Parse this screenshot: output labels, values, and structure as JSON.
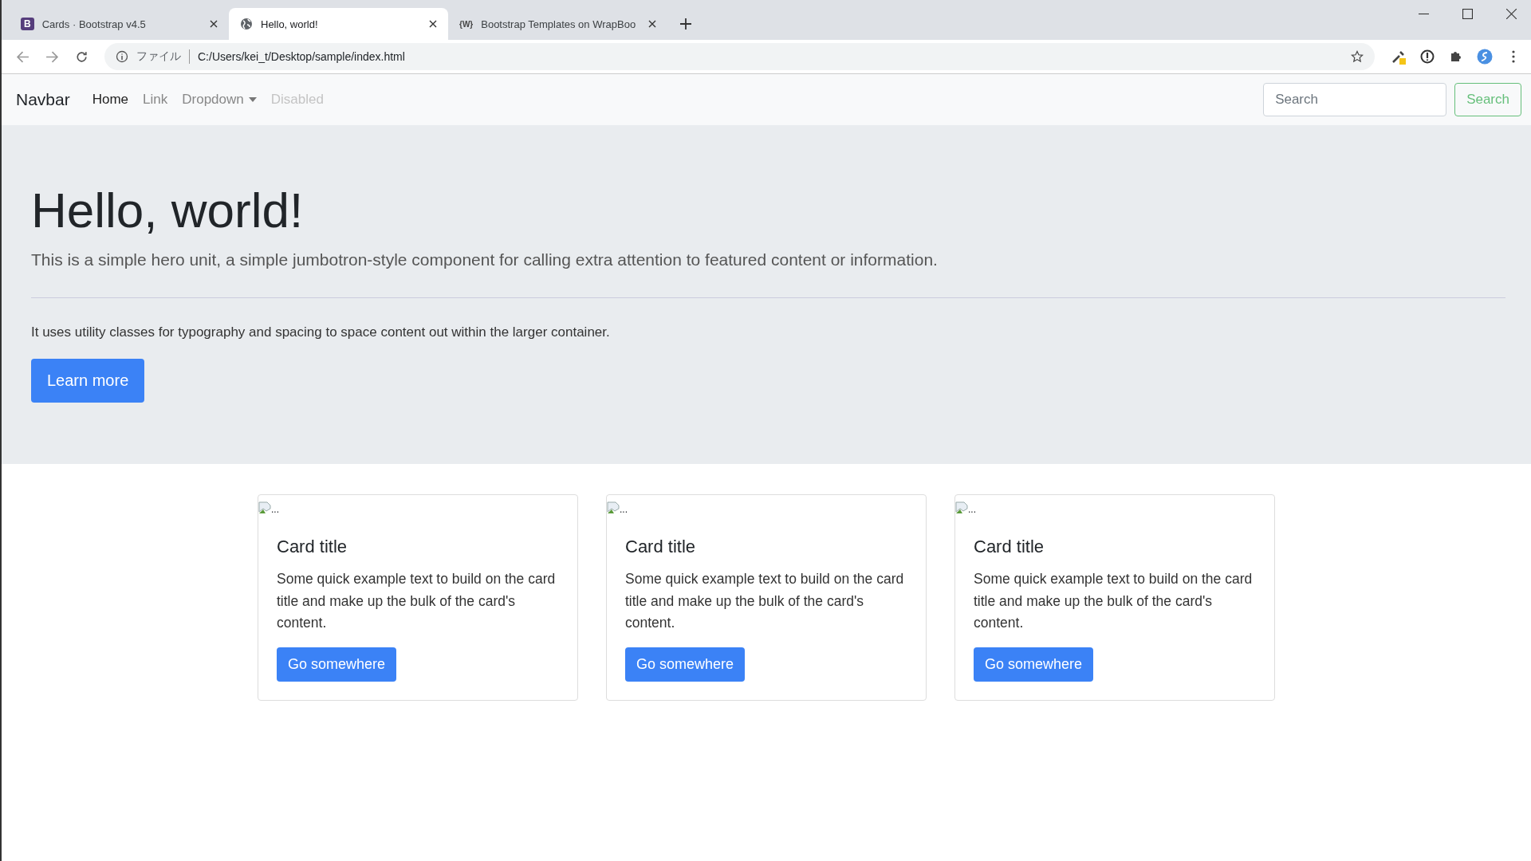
{
  "browser": {
    "tabs": [
      {
        "title": "Cards · Bootstrap v4.5",
        "selected": false,
        "kind": "letter",
        "favicon_text": "B"
      },
      {
        "title": "Hello, world!",
        "selected": true,
        "kind": "globe"
      },
      {
        "title": "Bootstrap Templates on WrapBoo",
        "selected": false,
        "kind": "letter",
        "favicon_text": "{W}"
      }
    ],
    "address": {
      "scheme_label": "ファイル",
      "url": "C:/Users/kei_t/Desktop/sample/index.html"
    }
  },
  "navbar": {
    "brand": "Navbar",
    "items": [
      {
        "label": "Home",
        "selected": true,
        "disabled": false,
        "kind": "link"
      },
      {
        "label": "Link",
        "selected": false,
        "disabled": false,
        "kind": "link"
      },
      {
        "label": "Dropdown",
        "selected": false,
        "disabled": false,
        "kind": "dropdown"
      },
      {
        "label": "Disabled",
        "selected": false,
        "disabled": true,
        "kind": "link"
      }
    ],
    "search": {
      "placeholder": "Search",
      "button": "Search"
    }
  },
  "jumbotron": {
    "heading": "Hello, world!",
    "lead": "This is a simple hero unit, a simple jumbotron-style component for calling extra attention to featured content or information.",
    "text": "It uses utility classes for typography and spacing to space content out within the larger container.",
    "button": "Learn more"
  },
  "cards": [
    {
      "image_alt": "...",
      "title": "Card title",
      "text": "Some quick example text to build on the card title and make up the bulk of the card's content.",
      "button": "Go somewhere"
    },
    {
      "image_alt": "...",
      "title": "Card title",
      "text": "Some quick example text to build on the card title and make up the bulk of the card's content.",
      "button": "Go somewhere"
    },
    {
      "image_alt": "...",
      "title": "Card title",
      "text": "Some quick example text to build on the card title and make up the bulk of the card's content.",
      "button": "Go somewhere"
    }
  ]
}
